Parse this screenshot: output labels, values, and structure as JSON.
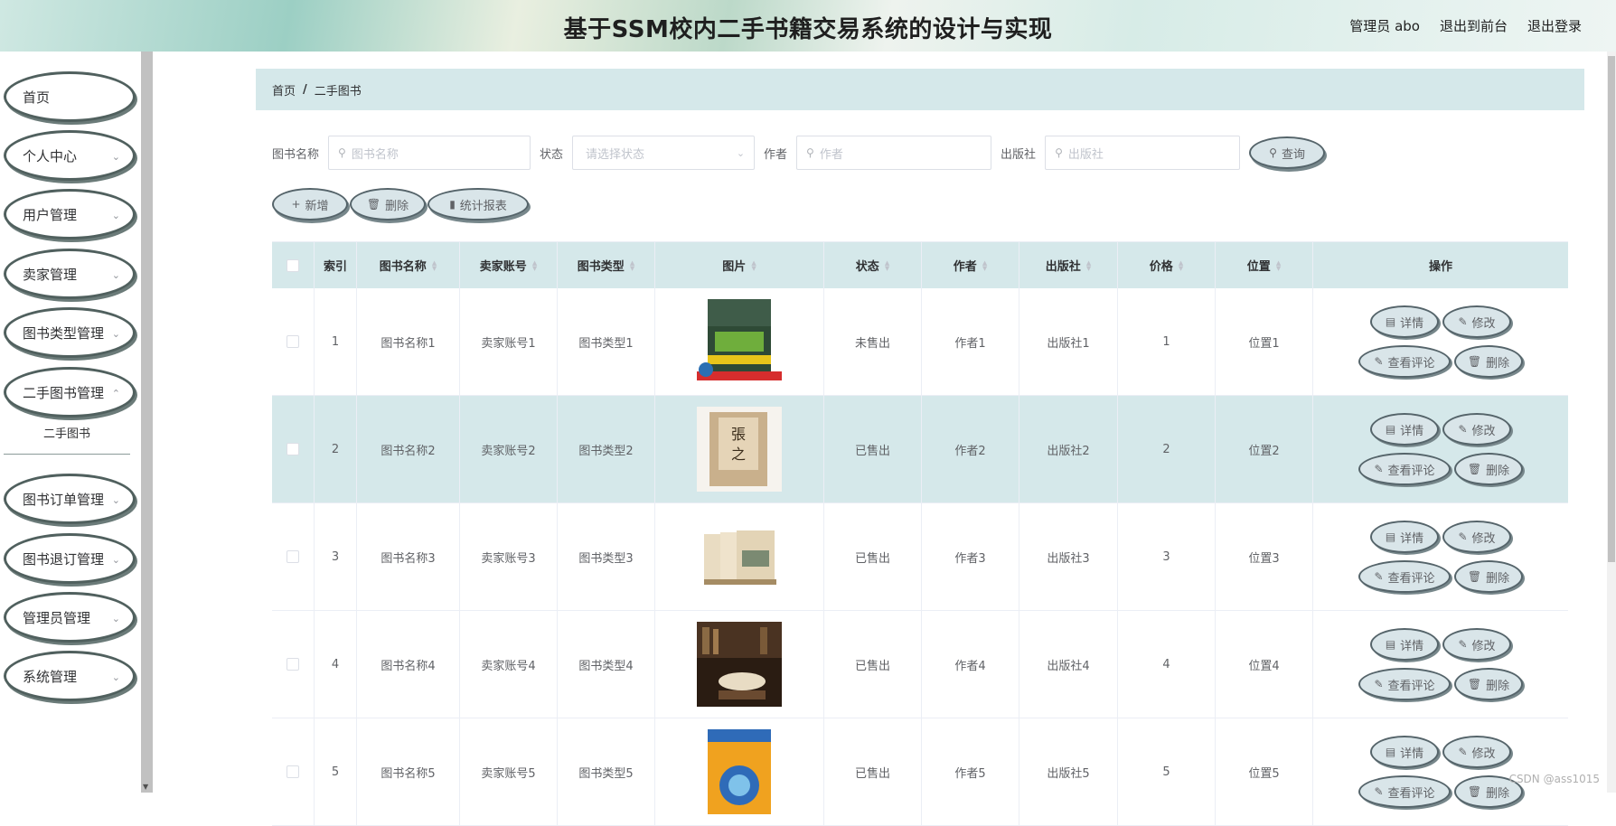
{
  "header": {
    "title": "基于SSM校内二手书籍交易系统的设计与实现",
    "admin": "管理员 abo",
    "to_front": "退出到前台",
    "logout": "退出登录"
  },
  "sidebar": {
    "items": [
      {
        "label": "首页"
      },
      {
        "label": "个人中心"
      },
      {
        "label": "用户管理"
      },
      {
        "label": "卖家管理"
      },
      {
        "label": "图书类型管理"
      },
      {
        "label": "二手图书管理"
      },
      {
        "label": "图书订单管理"
      },
      {
        "label": "图书退订管理"
      },
      {
        "label": "管理员管理"
      },
      {
        "label": "系统管理"
      }
    ],
    "submenu_active": "二手图书"
  },
  "breadcrumb": {
    "home": "首页",
    "separator": "/",
    "current": "二手图书"
  },
  "search": {
    "book_name_label": "图书名称",
    "book_name_placeholder": "图书名称",
    "status_label": "状态",
    "status_placeholder": "请选择状态",
    "author_label": "作者",
    "author_placeholder": "作者",
    "publisher_label": "出版社",
    "publisher_placeholder": "出版社",
    "query_button": "查询"
  },
  "actions": {
    "add": "新增",
    "delete": "删除",
    "report": "统计报表"
  },
  "table": {
    "columns": [
      "",
      "索引",
      "图书名称",
      "卖家账号",
      "图书类型",
      "图片",
      "状态",
      "作者",
      "出版社",
      "价格",
      "位置",
      "操作"
    ],
    "rows": [
      {
        "index": "1",
        "name": "图书名称1",
        "seller": "卖家账号1",
        "type": "图书类型1",
        "status": "未售出",
        "author": "作者1",
        "publisher": "出版社1",
        "price": "1",
        "location": "位置1"
      },
      {
        "index": "2",
        "name": "图书名称2",
        "seller": "卖家账号2",
        "type": "图书类型2",
        "status": "已售出",
        "author": "作者2",
        "publisher": "出版社2",
        "price": "2",
        "location": "位置2"
      },
      {
        "index": "3",
        "name": "图书名称3",
        "seller": "卖家账号3",
        "type": "图书类型3",
        "status": "已售出",
        "author": "作者3",
        "publisher": "出版社3",
        "price": "3",
        "location": "位置3"
      },
      {
        "index": "4",
        "name": "图书名称4",
        "seller": "卖家账号4",
        "type": "图书类型4",
        "status": "已售出",
        "author": "作者4",
        "publisher": "出版社4",
        "price": "4",
        "location": "位置4"
      },
      {
        "index": "5",
        "name": "图书名称5",
        "seller": "卖家账号5",
        "type": "图书类型5",
        "status": "已售出",
        "author": "作者5",
        "publisher": "出版社5",
        "price": "5",
        "location": "位置5"
      }
    ],
    "ops": {
      "detail": "详情",
      "edit": "修改",
      "comments": "查看评论",
      "delete": "删除"
    }
  },
  "watermark": "CSDN @ass1015"
}
